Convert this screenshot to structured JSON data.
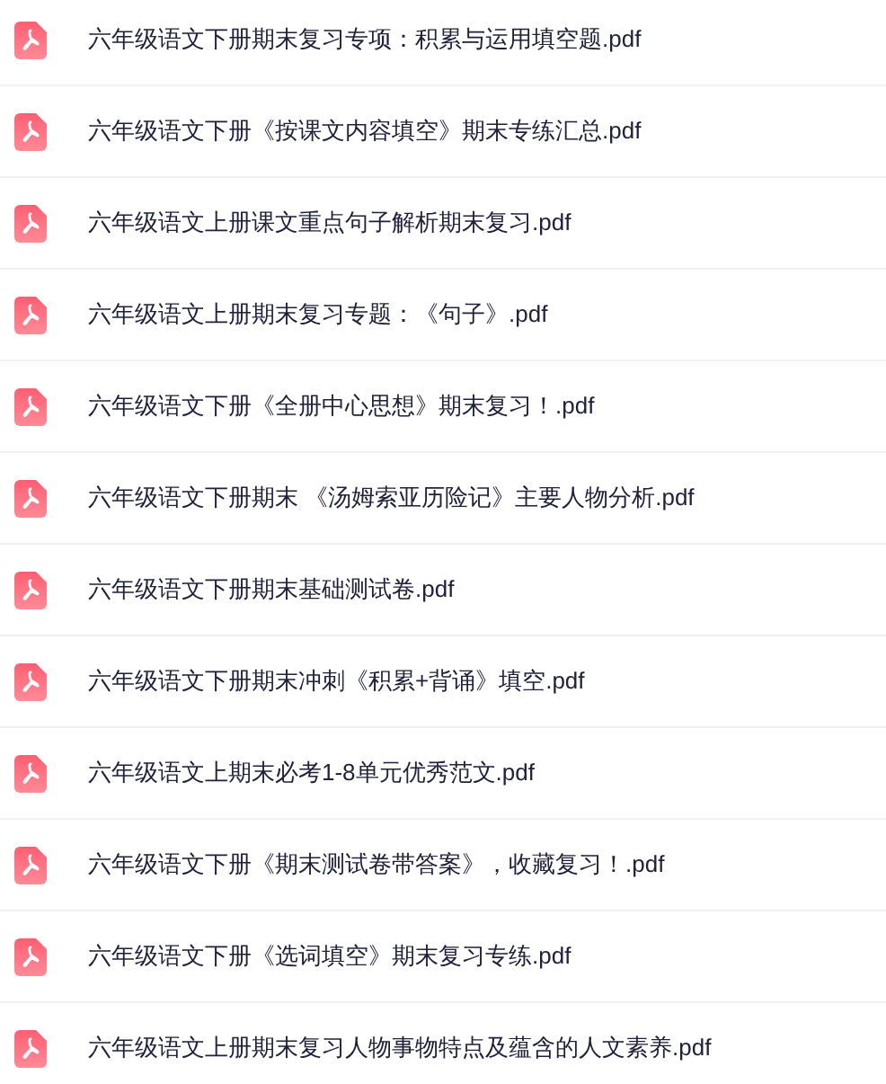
{
  "files": [
    {
      "name": "六年级语文下册期末复习专项：积累与运用填空题.pdf"
    },
    {
      "name": "六年级语文下册《按课文内容填空》期末专练汇总.pdf"
    },
    {
      "name": "六年级语文上册课文重点句子解析期末复习.pdf"
    },
    {
      "name": "六年级语文上册期末复习专题：《句子》.pdf"
    },
    {
      "name": "六年级语文下册《全册中心思想》期末复习！.pdf"
    },
    {
      "name": "六年级语文下册期末 《汤姆索亚历险记》主要人物分析.pdf"
    },
    {
      "name": "六年级语文下册期末基础测试卷.pdf"
    },
    {
      "name": "六年级语文下册期末冲刺《积累+背诵》填空.pdf"
    },
    {
      "name": "六年级语文上期末必考1-8单元优秀范文.pdf"
    },
    {
      "name": "六年级语文下册《期末测试卷带答案》，收藏复习！.pdf"
    },
    {
      "name": "六年级语文下册《选词填空》期末复习专练.pdf"
    },
    {
      "name": "六年级语文上册期末复习人物事物特点及蕴含的人文素养.pdf"
    }
  ]
}
